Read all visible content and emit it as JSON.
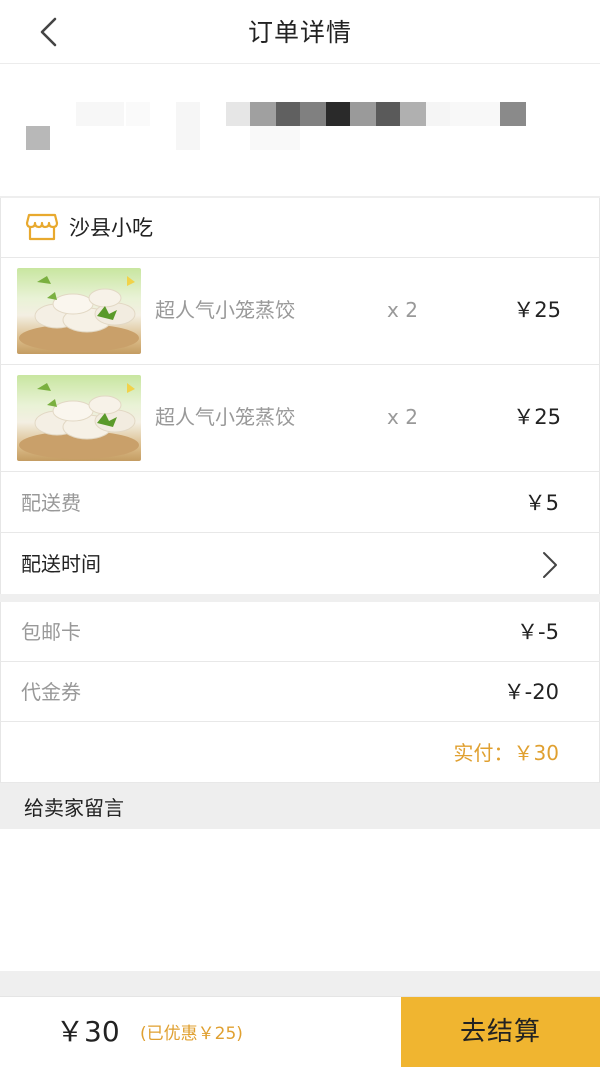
{
  "header": {
    "title": "订单详情"
  },
  "shop": {
    "name": "沙县小吃"
  },
  "items": [
    {
      "name": "超人气小笼蒸饺",
      "qty": "x 2",
      "price": "￥25"
    },
    {
      "name": "超人气小笼蒸饺",
      "qty": "x 2",
      "price": "￥25"
    }
  ],
  "delivery_fee": {
    "label": "配送费",
    "value": "￥5"
  },
  "delivery_time": {
    "label": "配送时间"
  },
  "mail_card": {
    "label": "包邮卡",
    "value": "￥-5"
  },
  "voucher": {
    "label": "代金券",
    "value": "￥-20"
  },
  "paid": {
    "text": "实付：￥30"
  },
  "message": {
    "label": "给卖家留言"
  },
  "footer": {
    "total": "￥30",
    "discount": "(已优惠￥25)",
    "checkout_label": "去结算"
  },
  "colors": {
    "accent": "#f0b530",
    "accent_text": "#e0a030"
  }
}
